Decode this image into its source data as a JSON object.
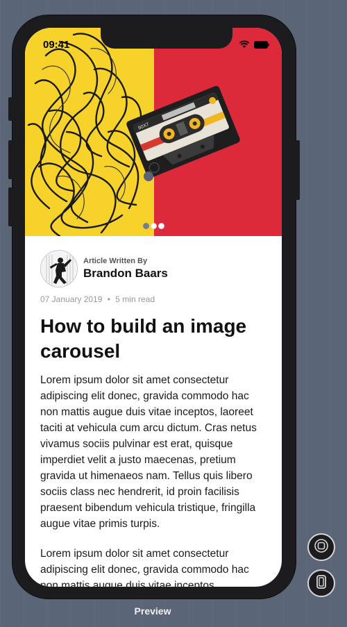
{
  "status": {
    "time": "09:41",
    "wifi_icon": "wifi-icon",
    "battery_icon": "battery-icon"
  },
  "carousel": {
    "slide_count": 3,
    "active_index": 0,
    "colors": {
      "left": "#f7d22b",
      "right": "#dc2a3b"
    }
  },
  "article": {
    "author_caption": "Article Written By",
    "author_name": "Brandon Baars",
    "date": "07 January 2019",
    "separator": "•",
    "read_time": "5 min read",
    "title": "How to build an image carousel",
    "paragraphs": [
      "Lorem ipsum dolor sit amet consectetur adipiscing elit donec, gravida commodo hac non mattis augue duis vitae inceptos, laoreet taciti at vehicula cum arcu dictum. Cras netus vivamus sociis pulvinar est erat, quisque imperdiet velit a justo maecenas, pretium gravida ut himenaeos nam. Tellus quis libero sociis class nec hendrerit, id proin facilisis praesent bibendum vehicula tristique, fringilla augue vitae primis turpis.",
      "Lorem ipsum dolor sit amet consectetur adipiscing elit donec, gravida commodo hac non mattis augue duis vitae inceptos"
    ]
  },
  "controls": {
    "preview_label": "Preview",
    "home_icon": "home-icon",
    "device_icon": "device-icon"
  }
}
